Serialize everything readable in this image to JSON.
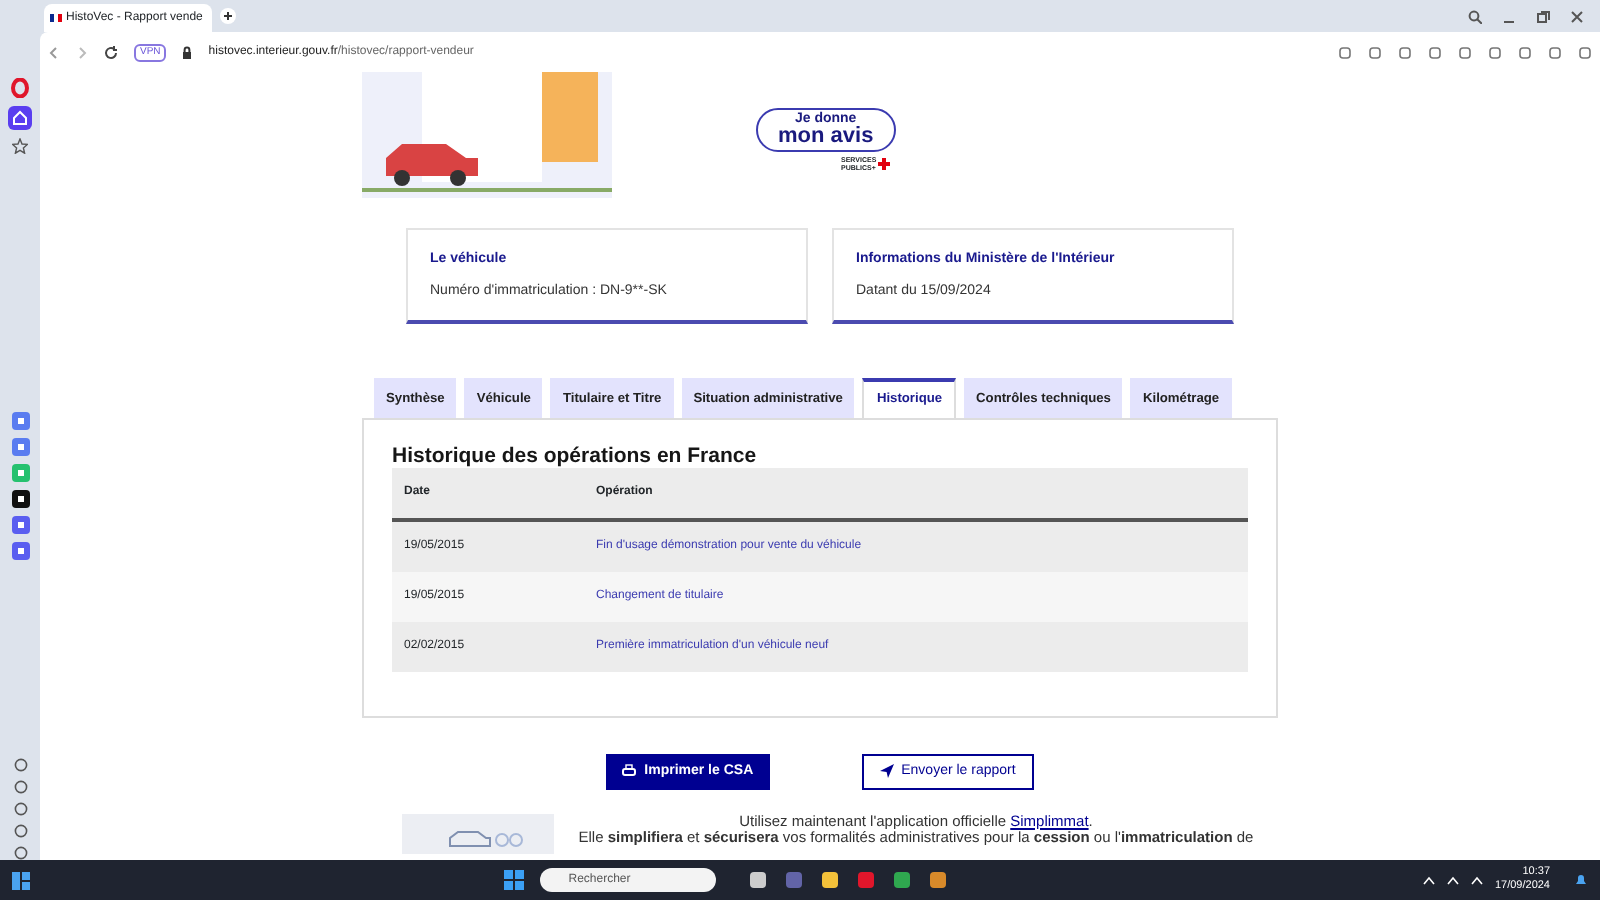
{
  "browser": {
    "tab_title": "HistoVec - Rapport vende",
    "url_host": "histovec.interieur.gouv.fr",
    "url_path": "/histovec/rapport-vendeur",
    "badge": "VPN"
  },
  "feedback": {
    "lines": [
      "Je donne",
      "mon avis"
    ],
    "logo_text": [
      "SERVICES",
      "PUBLICS+"
    ]
  },
  "cards": [
    {
      "title": "Le véhicule",
      "text": "Numéro d'immatriculation : DN-9**-SK"
    },
    {
      "title": "Informations du Ministère de l'Intérieur",
      "text": "Datant du 15/09/2024"
    }
  ],
  "tabs": [
    {
      "label": "Synthèse",
      "selected": false
    },
    {
      "label": "Véhicule",
      "selected": false
    },
    {
      "label": "Titulaire et Titre",
      "selected": false
    },
    {
      "label": "Situation administrative",
      "selected": false
    },
    {
      "label": "Historique",
      "selected": true
    },
    {
      "label": "Contrôles techniques",
      "selected": false
    },
    {
      "label": "Kilométrage",
      "selected": false
    }
  ],
  "section_title": "Historique des opérations en France",
  "table": {
    "columns": [
      "Date",
      "Opération"
    ],
    "rows": [
      {
        "date": "19/05/2015",
        "operation": "Fin d'usage démonstration pour vente du véhicule"
      },
      {
        "date": "19/05/2015",
        "operation": "Changement de titulaire"
      },
      {
        "date": "02/02/2015",
        "operation": "Première immatriculation d'un véhicule neuf"
      }
    ]
  },
  "buttons": [
    {
      "kind": "primary",
      "label": "Imprimer le CSA"
    },
    {
      "kind": "secondary",
      "label": "Envoyer le rapport"
    }
  ],
  "promo": {
    "before": "Utilisez maintenant l'application officielle",
    "link": "Simplimmat",
    "after": ".",
    "line2": "Elle **simplifiera** et **sécurisera** vos formalités administratives pour la **cession** ou l'**immatriculation** de"
  },
  "taskbar": {
    "search_placeholder": "Rechercher",
    "time": "10:37",
    "date": "17/09/2024"
  }
}
